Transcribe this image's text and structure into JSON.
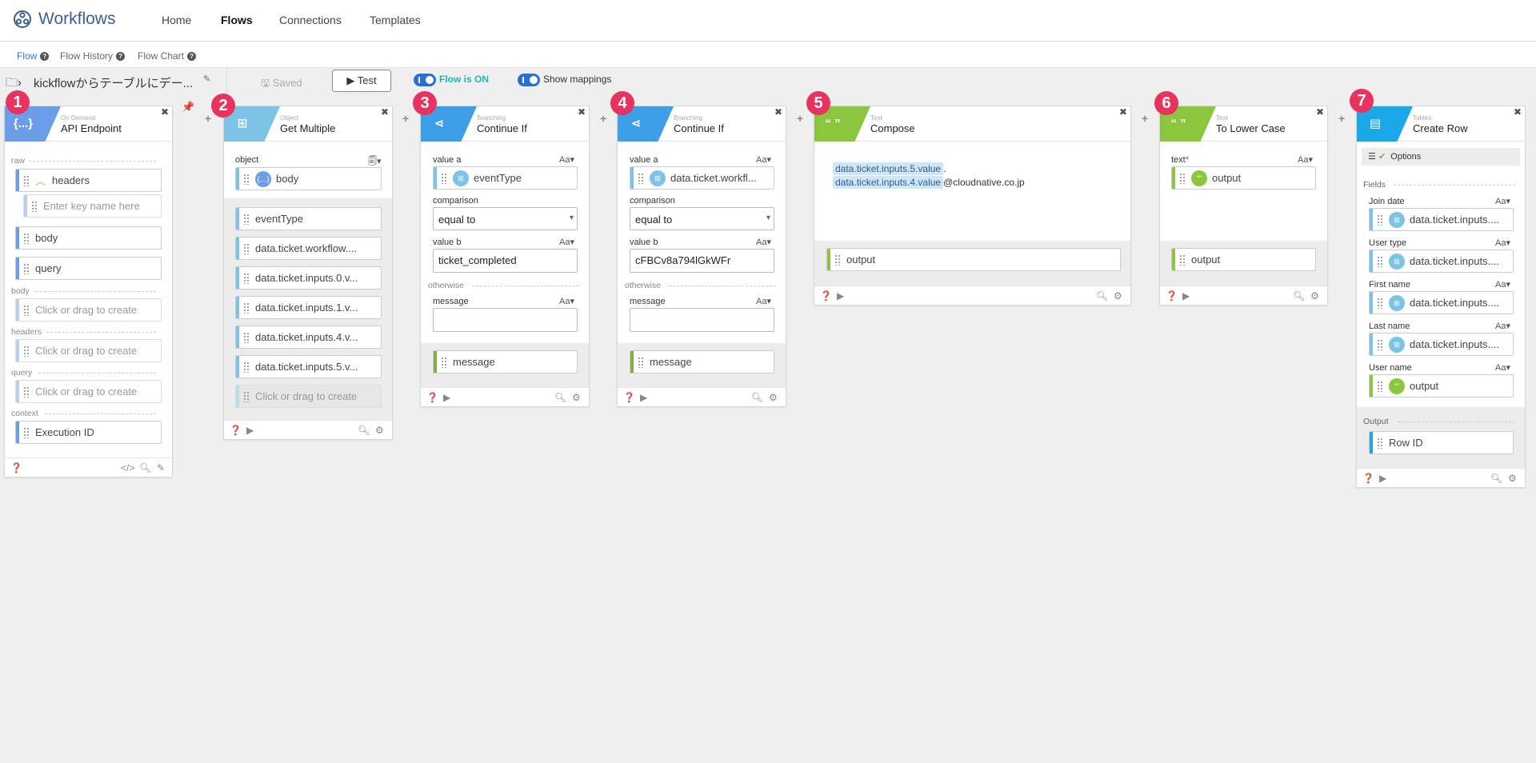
{
  "app": {
    "name": "Workflows",
    "nav": [
      "Home",
      "Flows",
      "Connections",
      "Templates"
    ],
    "active_nav": "Flows"
  },
  "subnav": [
    "Flow",
    "Flow History",
    "Flow Chart"
  ],
  "toolbar": {
    "flow_name": "kickflowからテーブルにデー...",
    "saved": "Saved",
    "test": "Test",
    "flow_on": "Flow is ON",
    "show_mappings": "Show mappings"
  },
  "cards": [
    {
      "n": "1",
      "cat": "On Demand",
      "title": "API Endpoint",
      "icon": "{...}",
      "color": "#6b9ee8",
      "raw_label": "raw",
      "rows": [
        "headers",
        "Enter key name here",
        "body",
        "query"
      ],
      "sections": [
        {
          "label": "body",
          "placeholder": "Click or drag to create"
        },
        {
          "label": "headers",
          "placeholder": "Click or drag to create"
        },
        {
          "label": "query",
          "placeholder": "Click or drag to create"
        },
        {
          "label": "context",
          "value": "Execution ID"
        }
      ]
    },
    {
      "n": "2",
      "cat": "Object",
      "title": "Get Multiple",
      "icon": "⊞",
      "color": "#7cc3e6",
      "object_label": "object",
      "object_value": "body",
      "outputs": [
        "eventType",
        "data.ticket.workflow....",
        "data.ticket.inputs.0.v...",
        "data.ticket.inputs.1.v...",
        "data.ticket.inputs.4.v...",
        "data.ticket.inputs.5.v..."
      ],
      "placeholder": "Click or drag to create"
    },
    {
      "n": "3",
      "cat": "Branching",
      "title": "Continue If",
      "color": "#3d9fe8",
      "value_a_label": "value a",
      "value_a": "eventType",
      "comparison_label": "comparison",
      "comparison": "equal to",
      "value_b_label": "value b",
      "value_b": "ticket_completed",
      "otherwise": "otherwise",
      "message_label": "message",
      "out": "message"
    },
    {
      "n": "4",
      "cat": "Branching",
      "title": "Continue If",
      "color": "#3d9fe8",
      "value_a_label": "value a",
      "value_a": "data.ticket.workfl...",
      "comparison_label": "comparison",
      "comparison": "equal to",
      "value_b_label": "value b",
      "value_b": "cFBCv8a794lGkWFr",
      "otherwise": "otherwise",
      "message_label": "message",
      "out": "message"
    },
    {
      "n": "5",
      "cat": "Text",
      "title": "Compose",
      "color": "#8cc63f",
      "icon": "“ ”",
      "token1": "data.ticket.inputs.5.value",
      "sep": ".",
      "token2": "data.ticket.inputs.4.value",
      "tail": "@cloudnative.co.jp",
      "out": "output"
    },
    {
      "n": "6",
      "cat": "Text",
      "title": "To Lower Case",
      "color": "#8cc63f",
      "icon": "“ ”",
      "text_label": "text",
      "required": "*",
      "input": "output",
      "out": "output"
    },
    {
      "n": "7",
      "cat": "Tables",
      "title": "Create Row",
      "color": "#1ba8e8",
      "options": "Options",
      "fields_label": "Fields",
      "fields": [
        {
          "label": "Join date",
          "value": "data.ticket.inputs...."
        },
        {
          "label": "User type",
          "value": "data.ticket.inputs...."
        },
        {
          "label": "First name",
          "value": "data.ticket.inputs...."
        },
        {
          "label": "Last name",
          "value": "data.ticket.inputs...."
        },
        {
          "label": "User name",
          "value": "output"
        }
      ],
      "output_label": "Output",
      "output": "Row ID"
    }
  ],
  "aa": "Aa▾"
}
